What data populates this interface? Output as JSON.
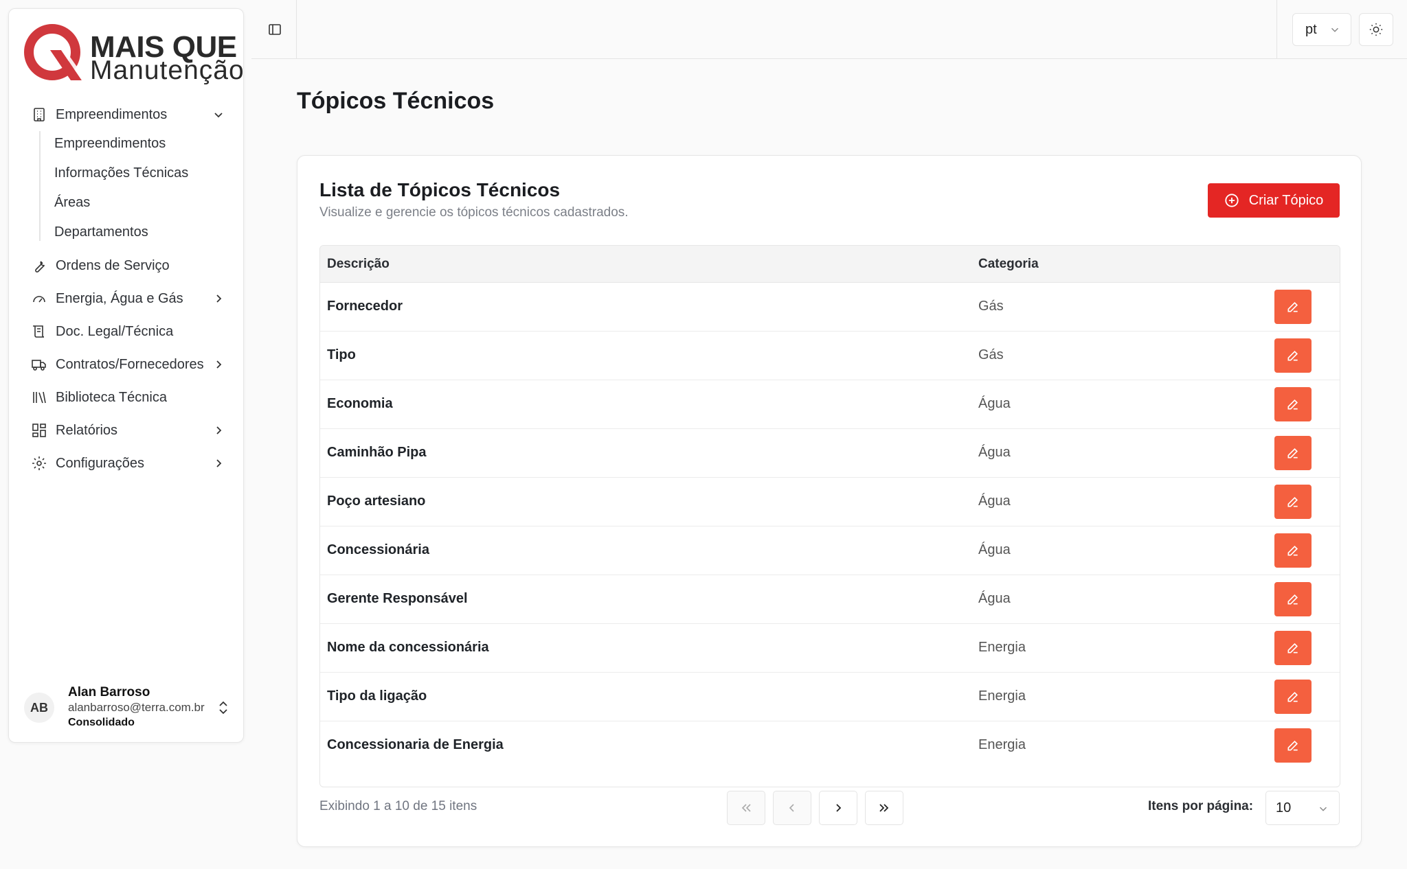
{
  "brand": {
    "line1": "MAIS QUE",
    "line2": "Manutenção",
    "color": "#d0383d"
  },
  "sidebar": {
    "nav": [
      {
        "label": "Empreendimentos",
        "icon": "building-icon",
        "expanded": true
      },
      {
        "label": "Ordens de Serviço",
        "icon": "wrench-icon"
      },
      {
        "label": "Energia, Água e Gás",
        "icon": "gauge-icon"
      },
      {
        "label": "Doc. Legal/Técnica",
        "icon": "scroll-icon"
      },
      {
        "label": "Contratos/Fornecedores",
        "icon": "truck-icon"
      },
      {
        "label": "Biblioteca Técnica",
        "icon": "library-icon"
      },
      {
        "label": "Relatórios",
        "icon": "dashboard-icon"
      },
      {
        "label": "Configurações",
        "icon": "gear-icon"
      }
    ],
    "subitems": [
      "Empreendimentos",
      "Informações Técnicas",
      "Áreas",
      "Departamentos"
    ]
  },
  "user": {
    "initials": "AB",
    "name": "Alan Barroso",
    "email": "alanbarroso@terra.com.br",
    "org": "Consolidado"
  },
  "topbar": {
    "language": "pt"
  },
  "page": {
    "title": "Tópicos Técnicos"
  },
  "card": {
    "title": "Lista de Tópicos Técnicos",
    "subtitle": "Visualize e gerencie os tópicos técnicos cadastrados.",
    "create_label": "Criar Tópico",
    "accent": "#e42624",
    "edit_color": "#f4603f"
  },
  "table": {
    "columns": [
      "Descrição",
      "Categoria"
    ],
    "rows": [
      {
        "description": "Fornecedor",
        "category": "Gás"
      },
      {
        "description": "Tipo",
        "category": "Gás"
      },
      {
        "description": "Economia",
        "category": "Água"
      },
      {
        "description": "Caminhão Pipa",
        "category": "Água"
      },
      {
        "description": "Poço artesiano",
        "category": "Água"
      },
      {
        "description": "Concessionária",
        "category": "Água"
      },
      {
        "description": "Gerente Responsável",
        "category": "Água"
      },
      {
        "description": "Nome da concessionária",
        "category": "Energia"
      },
      {
        "description": "Tipo da ligação",
        "category": "Energia"
      },
      {
        "description": "Concessionaria de Energia",
        "category": "Energia"
      }
    ]
  },
  "pagination": {
    "info": "Exibindo 1 a 10 de 15 itens",
    "per_page_label": "Itens por página:",
    "per_page_value": "10"
  }
}
